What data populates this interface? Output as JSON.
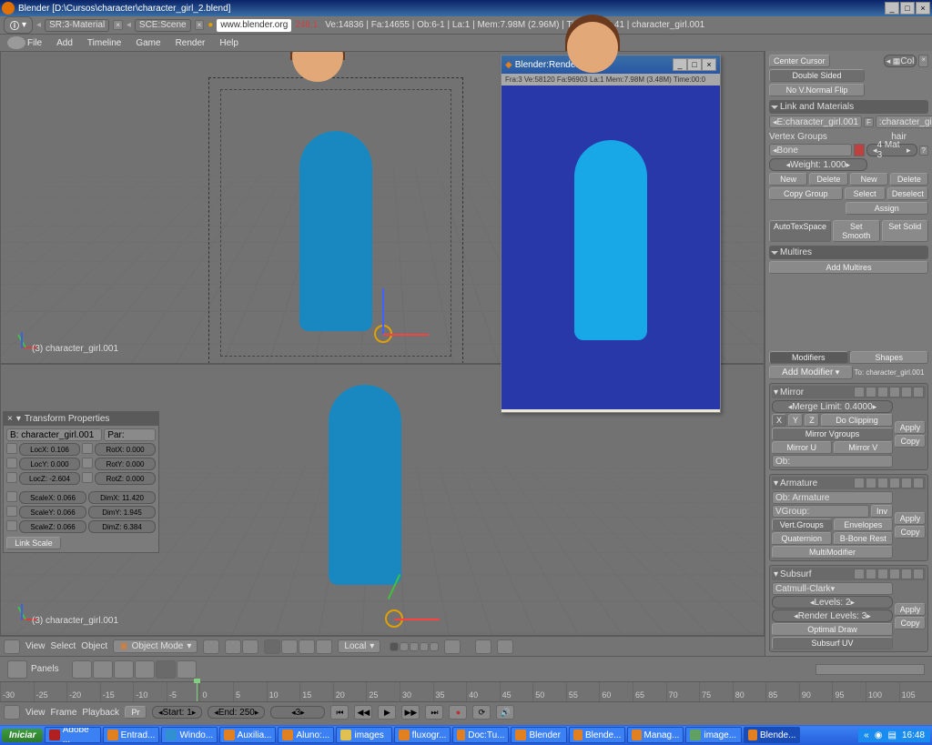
{
  "titlebar": {
    "text": "Blender [D:\\Cursos\\character\\character_girl_2.blend]"
  },
  "win_buttons": {
    "min": "_",
    "max": "□",
    "close": "×"
  },
  "infobar": {
    "screen": "SR:3-Material",
    "scene": "SCE:Scene",
    "url": "www.blender.org",
    "version": "248.1",
    "stats": "Ve:14836 | Fa:14655 | Ob:6-1 | La:1 | Mem:7.98M (2.96M) | Time:00:05.41 | character_girl.001"
  },
  "menubar": {
    "items": [
      "File",
      "Add",
      "Timeline",
      "Game",
      "Render",
      "Help"
    ]
  },
  "viewport": {
    "label": "(3) character_girl.001"
  },
  "render_win": {
    "title": "Blender:Render",
    "info": "Fra:3  Ve:58120 Fa:96903 La:1 Mem:7.98M (3.48M) Time:00:0"
  },
  "transform": {
    "title": "Transform Properties",
    "obj": "B: character_girl.001",
    "par": "Par:",
    "locx": "LocX: 0.106",
    "locy": "LocY: 0.000",
    "locz": "LocZ: -2.604",
    "rotx": "RotX: 0.000",
    "roty": "RotY: 0.000",
    "rotz": "RotZ: 0.000",
    "scalex": "ScaleX: 0.066",
    "scaley": "ScaleY: 0.066",
    "scalez": "ScaleZ: 0.066",
    "dimx": "DimX: 11.420",
    "dimy": "DimY: 1.945",
    "dimz": "DimZ: 6.384",
    "link": "Link Scale"
  },
  "vp_header": {
    "view": "View",
    "select": "Select",
    "object": "Object",
    "mode": "Object Mode",
    "orient": "Local"
  },
  "right": {
    "center": "Center Cursor",
    "col": "Col",
    "double": "Double Sided",
    "noflip": "No V.Normal Flip",
    "link_head": "Link and Materials",
    "mesh_link": "E:character_girl.001",
    "f": "F",
    "ob_link": ":character_girl.001",
    "vgroups": "Vertex Groups",
    "hair": "hair",
    "bone": "Bone",
    "weight": "Weight: 1.000",
    "mat": "4 Mat 3",
    "q": "?",
    "new": "New",
    "delete": "Delete",
    "copy_group": "Copy Group",
    "select": "Select",
    "deselect": "Deselect",
    "assign": "Assign",
    "autotex": "AutoTexSpace",
    "smooth": "Set Smooth",
    "solid": "Set Solid",
    "multires_head": "Multires",
    "add_multires": "Add Multires",
    "modifiers_tab": "Modifiers",
    "shapes_tab": "Shapes",
    "add_mod": "Add Modifier",
    "to": "To: character_girl.001",
    "mirror": "Mirror",
    "merge": "Merge Limit: 0.4000",
    "x": "X",
    "y": "Y",
    "z": "Z",
    "clip": "Do Clipping",
    "mvg": "Mirror Vgroups",
    "mu": "Mirror U",
    "mv": "Mirror V",
    "ob_lbl": "Ob:",
    "apply": "Apply",
    "copy": "Copy",
    "armature": "Armature",
    "ob_arm": "Ob: Armature",
    "vgroup": "VGroup:",
    "inv": "Inv",
    "vert_groups": "Vert.Groups",
    "envelopes": "Envelopes",
    "quat": "Quaternion",
    "bbone": "B-Bone Rest",
    "multimod": "MultiModifier",
    "subsurf": "Subsurf",
    "catmull": "Catmull-Clark",
    "levels": "Levels: 2",
    "rlevels": "Render Levels: 3",
    "optimal": "Optimal Draw",
    "subuv": "Subsurf UV"
  },
  "timeline": {
    "ticks": [
      "-30",
      "-25",
      "-20",
      "-15",
      "-10",
      "-5",
      "0",
      "5",
      "10",
      "15",
      "20",
      "25",
      "30",
      "35",
      "40",
      "45",
      "50",
      "55",
      "60",
      "65",
      "70",
      "75",
      "80",
      "85",
      "90",
      "95",
      "100",
      "105"
    ],
    "menu": [
      "View",
      "Frame",
      "Playback"
    ],
    "pr": "Pr",
    "start": "Start: 1",
    "end": "End: 250",
    "current": "3"
  },
  "btns_header": {
    "panels": "Panels"
  },
  "taskbar": {
    "start": "Iniciar",
    "items": [
      "Adobe ...",
      "Entrad...",
      "Windo...",
      "Auxilia...",
      "Aluno:...",
      "images",
      "fluxogr...",
      "Doc:Tu...",
      "Blender",
      "Blende...",
      "Manag...",
      "image...",
      "Blende..."
    ],
    "clock": "16:48"
  }
}
